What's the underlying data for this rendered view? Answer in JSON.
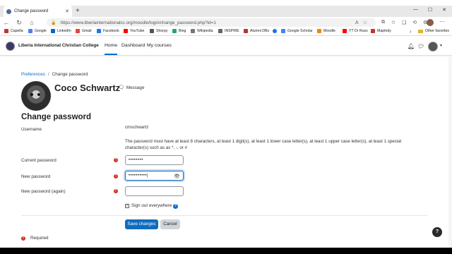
{
  "browser": {
    "tab_title": "Change password",
    "url": "https://www.liberiainternationalcc.org/moodle/login/change_password.php?id=1",
    "bookmarks": [
      "Capella",
      "Google",
      "LinkedIn",
      "Gmail",
      "Facebook",
      "YouTube",
      "Shorpy",
      "Bing",
      "Wikipedia",
      "INSPIRE",
      "Alumni DBs",
      "",
      "Google Scholar",
      "Moodle",
      "YT Dr Russ",
      "MapIndy"
    ],
    "other_favorites": "Other favorites"
  },
  "site": {
    "name": "Liberia International Christian College",
    "nav": [
      "Home",
      "Dashboard",
      "My courses"
    ]
  },
  "breadcrumb": {
    "link": "Preferences",
    "current": "Change password"
  },
  "user": {
    "name": "Coco Schwartz",
    "message_label": "Message"
  },
  "page": {
    "heading": "Change password"
  },
  "form": {
    "username_label": "Username",
    "username_value": "cmschwartz",
    "policy_text": "The password must have at least 8 characters, at least 1 digit(s), at least 1 lower case letter(s), at least 1 upper case letter(s), at least 1 special character(s) such as as *, -, or #",
    "current_label": "Current password",
    "current_value": "••••••••",
    "new_label": "New password",
    "new_value": "••••••••••|",
    "again_label": "New password (again)",
    "again_value": "",
    "signout_label": "Sign out everywhere",
    "save_label": "Save changes",
    "cancel_label": "Cancel",
    "required_label": "Required"
  },
  "colors": {
    "primary": "#0f6cbf",
    "required": "#ca3120"
  }
}
